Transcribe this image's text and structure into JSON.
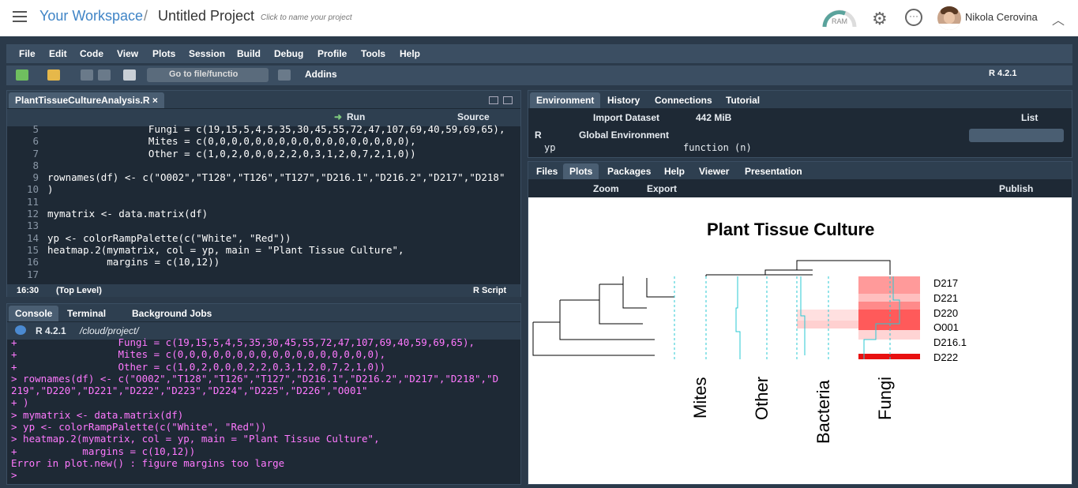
{
  "topbar": {
    "workspace": "Your Workspace",
    "separator": "/",
    "project": "Untitled Project",
    "project_hint": "Click to name your project",
    "ram_label": "RAM",
    "user_name": "Nikola Cerovina"
  },
  "menu": [
    "File",
    "Edit",
    "Code",
    "View",
    "Plots",
    "Session",
    "Build",
    "Debug",
    "Profile",
    "Tools",
    "Help"
  ],
  "toolbar": {
    "goto_placeholder": "Go to file/functio",
    "addins": "Addins",
    "r_version": "R 4.2.1"
  },
  "editor": {
    "tab": "PlantTissueCultureAnalysis.R",
    "run": "Run",
    "source": "Source",
    "line_numbers": [
      "5",
      "6",
      "7",
      "8",
      "9",
      "10",
      "11",
      "12",
      "13",
      "14",
      "15",
      "16",
      "17"
    ],
    "lines": [
      "                 Fungi = c(19,15,5,4,5,35,30,45,55,72,47,107,69,40,59,69,65),",
      "                 Mites = c(0,0,0,0,0,0,0,0,0,0,0,0,0,0,0,0,0),",
      "                 Other = c(1,0,2,0,0,0,2,2,0,3,1,2,0,7,2,1,0))",
      "",
      "rownames(df) <- c(\"O002\",\"T128\",\"T126\",\"T127\",\"D216.1\",\"D216.2\",\"D217\",\"D218\"",
      ")",
      "",
      "mymatrix <- data.matrix(df)",
      "",
      "yp <- colorRampPalette(c(\"White\", \"Red\"))",
      "heatmap.2(mymatrix, col = yp, main = \"Plant Tissue Culture\",",
      "          margins = c(10,12))",
      ""
    ],
    "cursor_pos": "16:30",
    "scope": "(Top Level)",
    "file_type": "R Script"
  },
  "console": {
    "tabs": [
      "Console",
      "Terminal",
      "Background Jobs"
    ],
    "version": "R 4.2.1",
    "path": "/cloud/project/",
    "lines": [
      "+                 Fungi = c(19,15,5,4,5,35,30,45,55,72,47,107,69,40,59,69,65),",
      "+                 Mites = c(0,0,0,0,0,0,0,0,0,0,0,0,0,0,0,0,0),",
      "+                 Other = c(1,0,2,0,0,0,2,2,0,3,1,2,0,7,2,1,0))",
      "> rownames(df) <- c(\"O002\",\"T128\",\"T126\",\"T127\",\"D216.1\",\"D216.2\",\"D217\",\"D218\",\"D",
      "219\",\"D220\",\"D221\",\"D222\",\"D223\",\"D224\",\"D225\",\"D226\",\"O001\"",
      "+ )",
      "> mymatrix <- data.matrix(df)",
      "> yp <- colorRampPalette(c(\"White\", \"Red\"))",
      "> heatmap.2(mymatrix, col = yp, main = \"Plant Tissue Culture\",",
      "+           margins = c(10,12))",
      "Error in plot.new() : figure margins too large",
      "> "
    ]
  },
  "environment": {
    "tabs": [
      "Environment",
      "History",
      "Connections",
      "Tutorial"
    ],
    "import": "Import Dataset",
    "memory": "442 MiB",
    "list": "List",
    "lang": "R",
    "scope": "Global Environment",
    "row_name": "yp",
    "row_value": "function (n)"
  },
  "plots": {
    "tabs": [
      "Files",
      "Plots",
      "Packages",
      "Help",
      "Viewer",
      "Presentation"
    ],
    "zoom": "Zoom",
    "export": "Export",
    "publish": "Publish"
  },
  "chart_data": {
    "type": "heatmap",
    "title": "Plant Tissue Culture",
    "row_labels": [
      "D217",
      "D221",
      "D220",
      "O001",
      "D216.1",
      "D222"
    ],
    "col_labels": [
      "Mites",
      "Other",
      "Bacteria",
      "Fungi"
    ]
  }
}
